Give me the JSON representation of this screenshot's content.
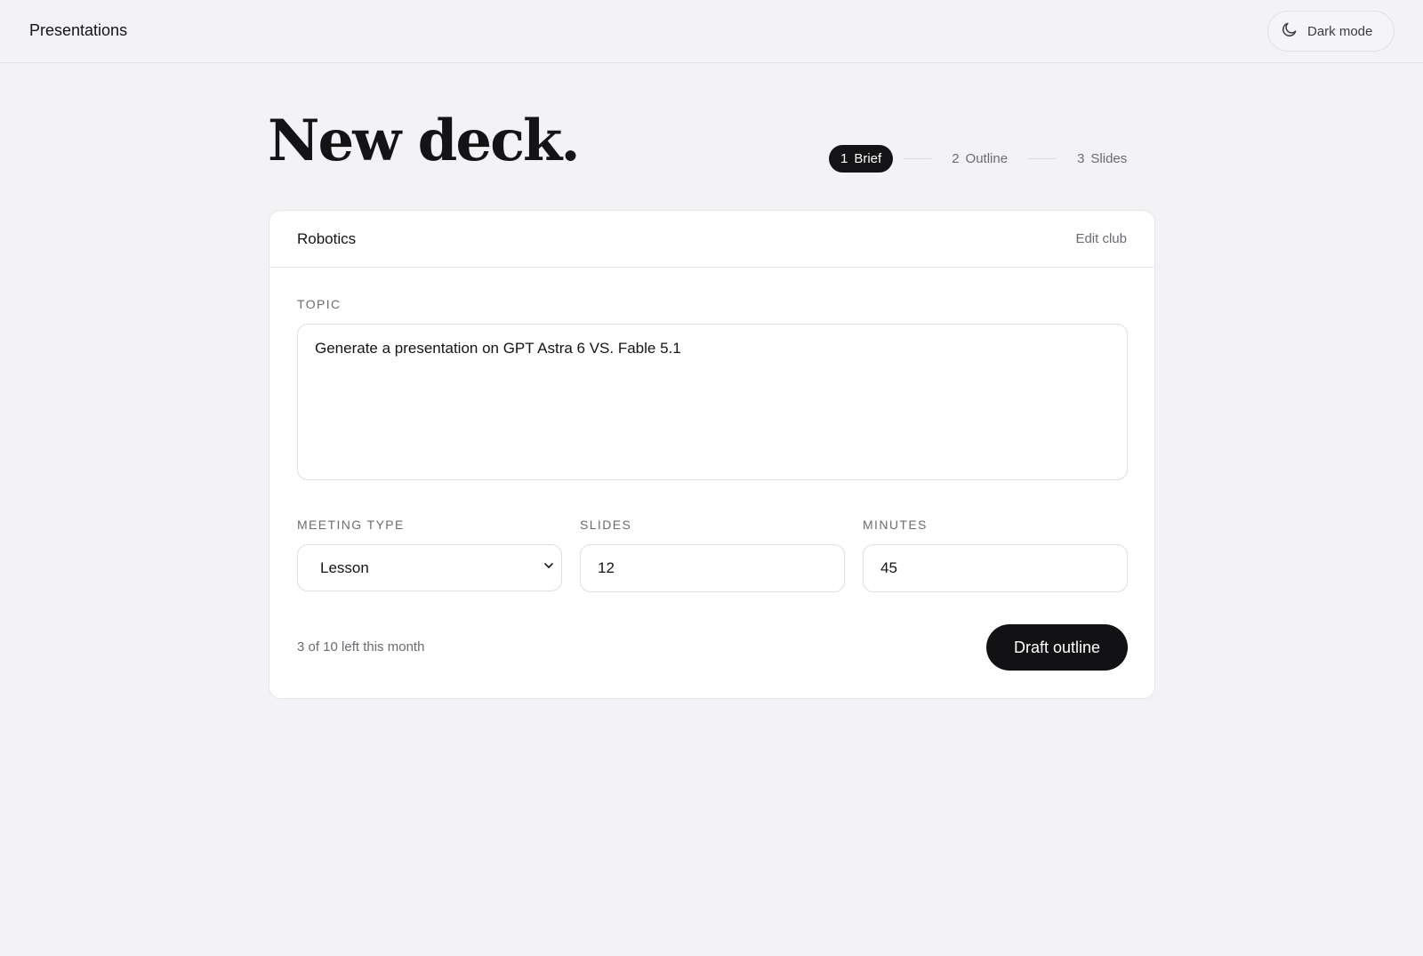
{
  "app": {
    "title": "Presentations"
  },
  "header": {
    "dark_mode_label": "Dark mode",
    "dark_mode_icon": "moon-icon"
  },
  "page": {
    "heading": "New deck."
  },
  "steps": [
    {
      "num": "1",
      "label": "Brief",
      "active": true
    },
    {
      "num": "2",
      "label": "Outline",
      "active": false
    },
    {
      "num": "3",
      "label": "Slides",
      "active": false
    }
  ],
  "card": {
    "club_name": "Robotics",
    "edit_label": "Edit club",
    "topic": {
      "label": "TOPIC",
      "value": "Generate a presentation on GPT Astra 6 VS. Fable 5.1"
    },
    "meeting_type": {
      "label": "MEETING TYPE",
      "value": "Lesson"
    },
    "slides": {
      "label": "SLIDES",
      "value": "12"
    },
    "minutes": {
      "label": "MINUTES",
      "value": "45"
    },
    "quota_text": "3 of 10 left this month",
    "submit_label": "Draft outline"
  },
  "colors": {
    "accent": "#141416",
    "background": "#f3f3f5",
    "card": "#ffffff"
  }
}
